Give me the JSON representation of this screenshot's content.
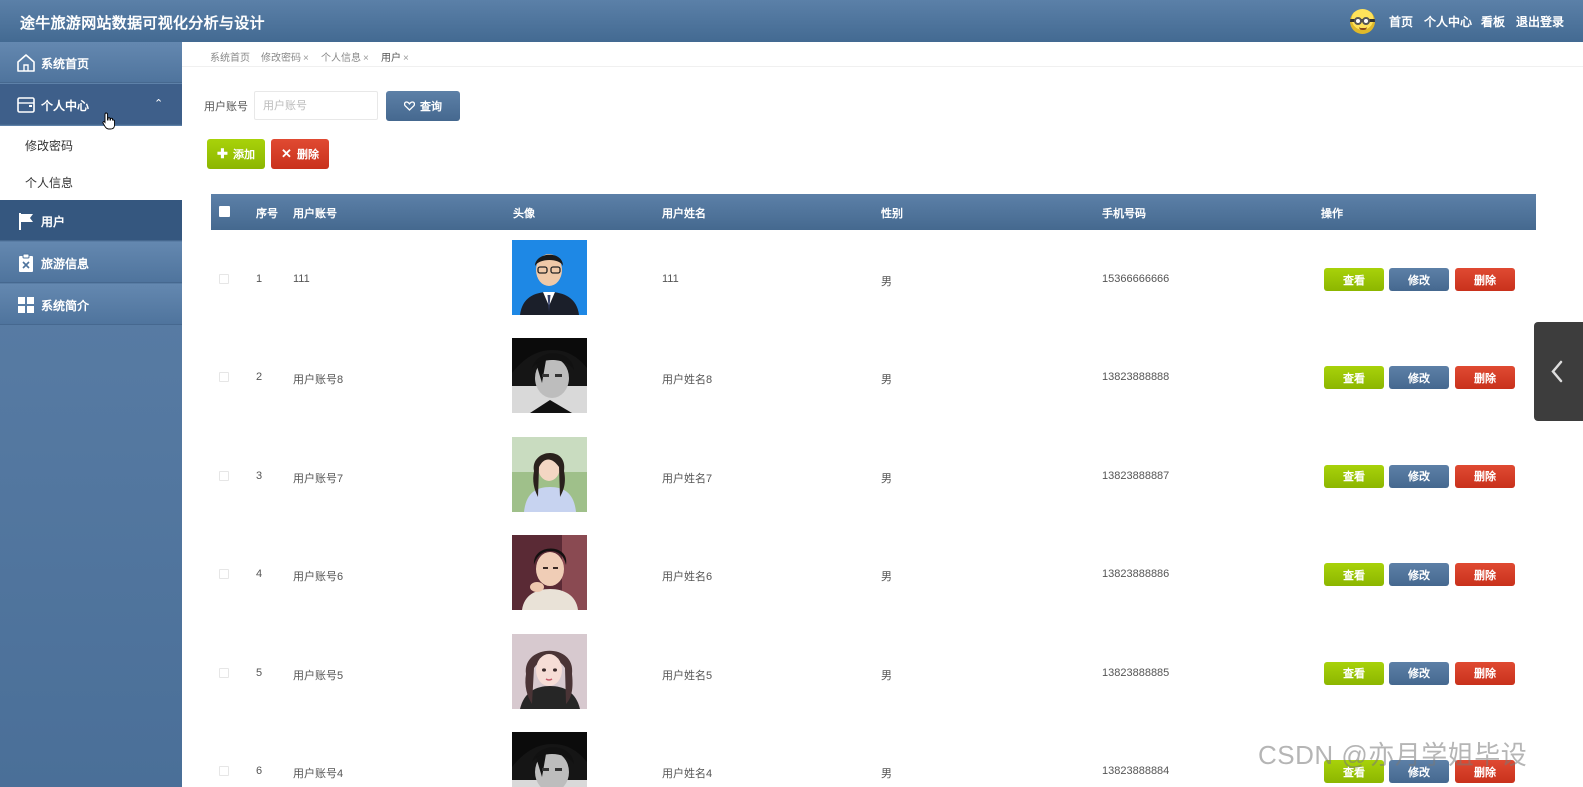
{
  "header": {
    "title": "途牛旅游网站数据可视化分析与设计",
    "nav": [
      "首页",
      "个人中心",
      "看板",
      "退出登录"
    ]
  },
  "sidebar": {
    "items": [
      {
        "label": "系统首页",
        "icon": "home-icon"
      },
      {
        "label": "个人中心",
        "icon": "wallet-icon"
      },
      {
        "label": "用户",
        "icon": "flag-icon"
      },
      {
        "label": "旅游信息",
        "icon": "clipboard-icon"
      },
      {
        "label": "系统简介",
        "icon": "grid-icon"
      }
    ],
    "submenu": [
      "修改密码",
      "个人信息"
    ]
  },
  "breadcrumbs": [
    {
      "label": "系统首页",
      "closable": false
    },
    {
      "label": "修改密码",
      "closable": true
    },
    {
      "label": "个人信息",
      "closable": true
    },
    {
      "label": "用户",
      "closable": true
    }
  ],
  "search": {
    "label": "用户账号",
    "placeholder": "用户账号",
    "query_label": "查询"
  },
  "toolbar": {
    "add_label": "添加",
    "delete_label": "删除"
  },
  "table": {
    "columns": [
      "序号",
      "用户账号",
      "头像",
      "用户姓名",
      "性别",
      "手机号码",
      "操作"
    ],
    "actions": {
      "view": "查看",
      "edit": "修改",
      "delete": "删除"
    },
    "rows": [
      {
        "index": "1",
        "account": "111",
        "name": "111",
        "gender": "男",
        "phone": "15366666666",
        "avatar": "suit"
      },
      {
        "index": "2",
        "account": "用户账号8",
        "name": "用户姓名8",
        "gender": "男",
        "phone": "13823888888",
        "avatar": "anime"
      },
      {
        "index": "3",
        "account": "用户账号7",
        "name": "用户姓名7",
        "gender": "男",
        "phone": "13823888887",
        "avatar": "girl-outdoor"
      },
      {
        "index": "4",
        "account": "用户账号6",
        "name": "用户姓名6",
        "gender": "男",
        "phone": "13823888886",
        "avatar": "boy"
      },
      {
        "index": "5",
        "account": "用户账号5",
        "name": "用户姓名5",
        "gender": "男",
        "phone": "13823888885",
        "avatar": "girl"
      },
      {
        "index": "6",
        "account": "用户账号4",
        "name": "用户姓名4",
        "gender": "男",
        "phone": "13823888884",
        "avatar": "anime"
      }
    ]
  },
  "watermark": "CSDN @亦月学姐毕设",
  "colors": {
    "primary": "#4e729a",
    "success": "#9bc505",
    "danger": "#d63c26"
  }
}
